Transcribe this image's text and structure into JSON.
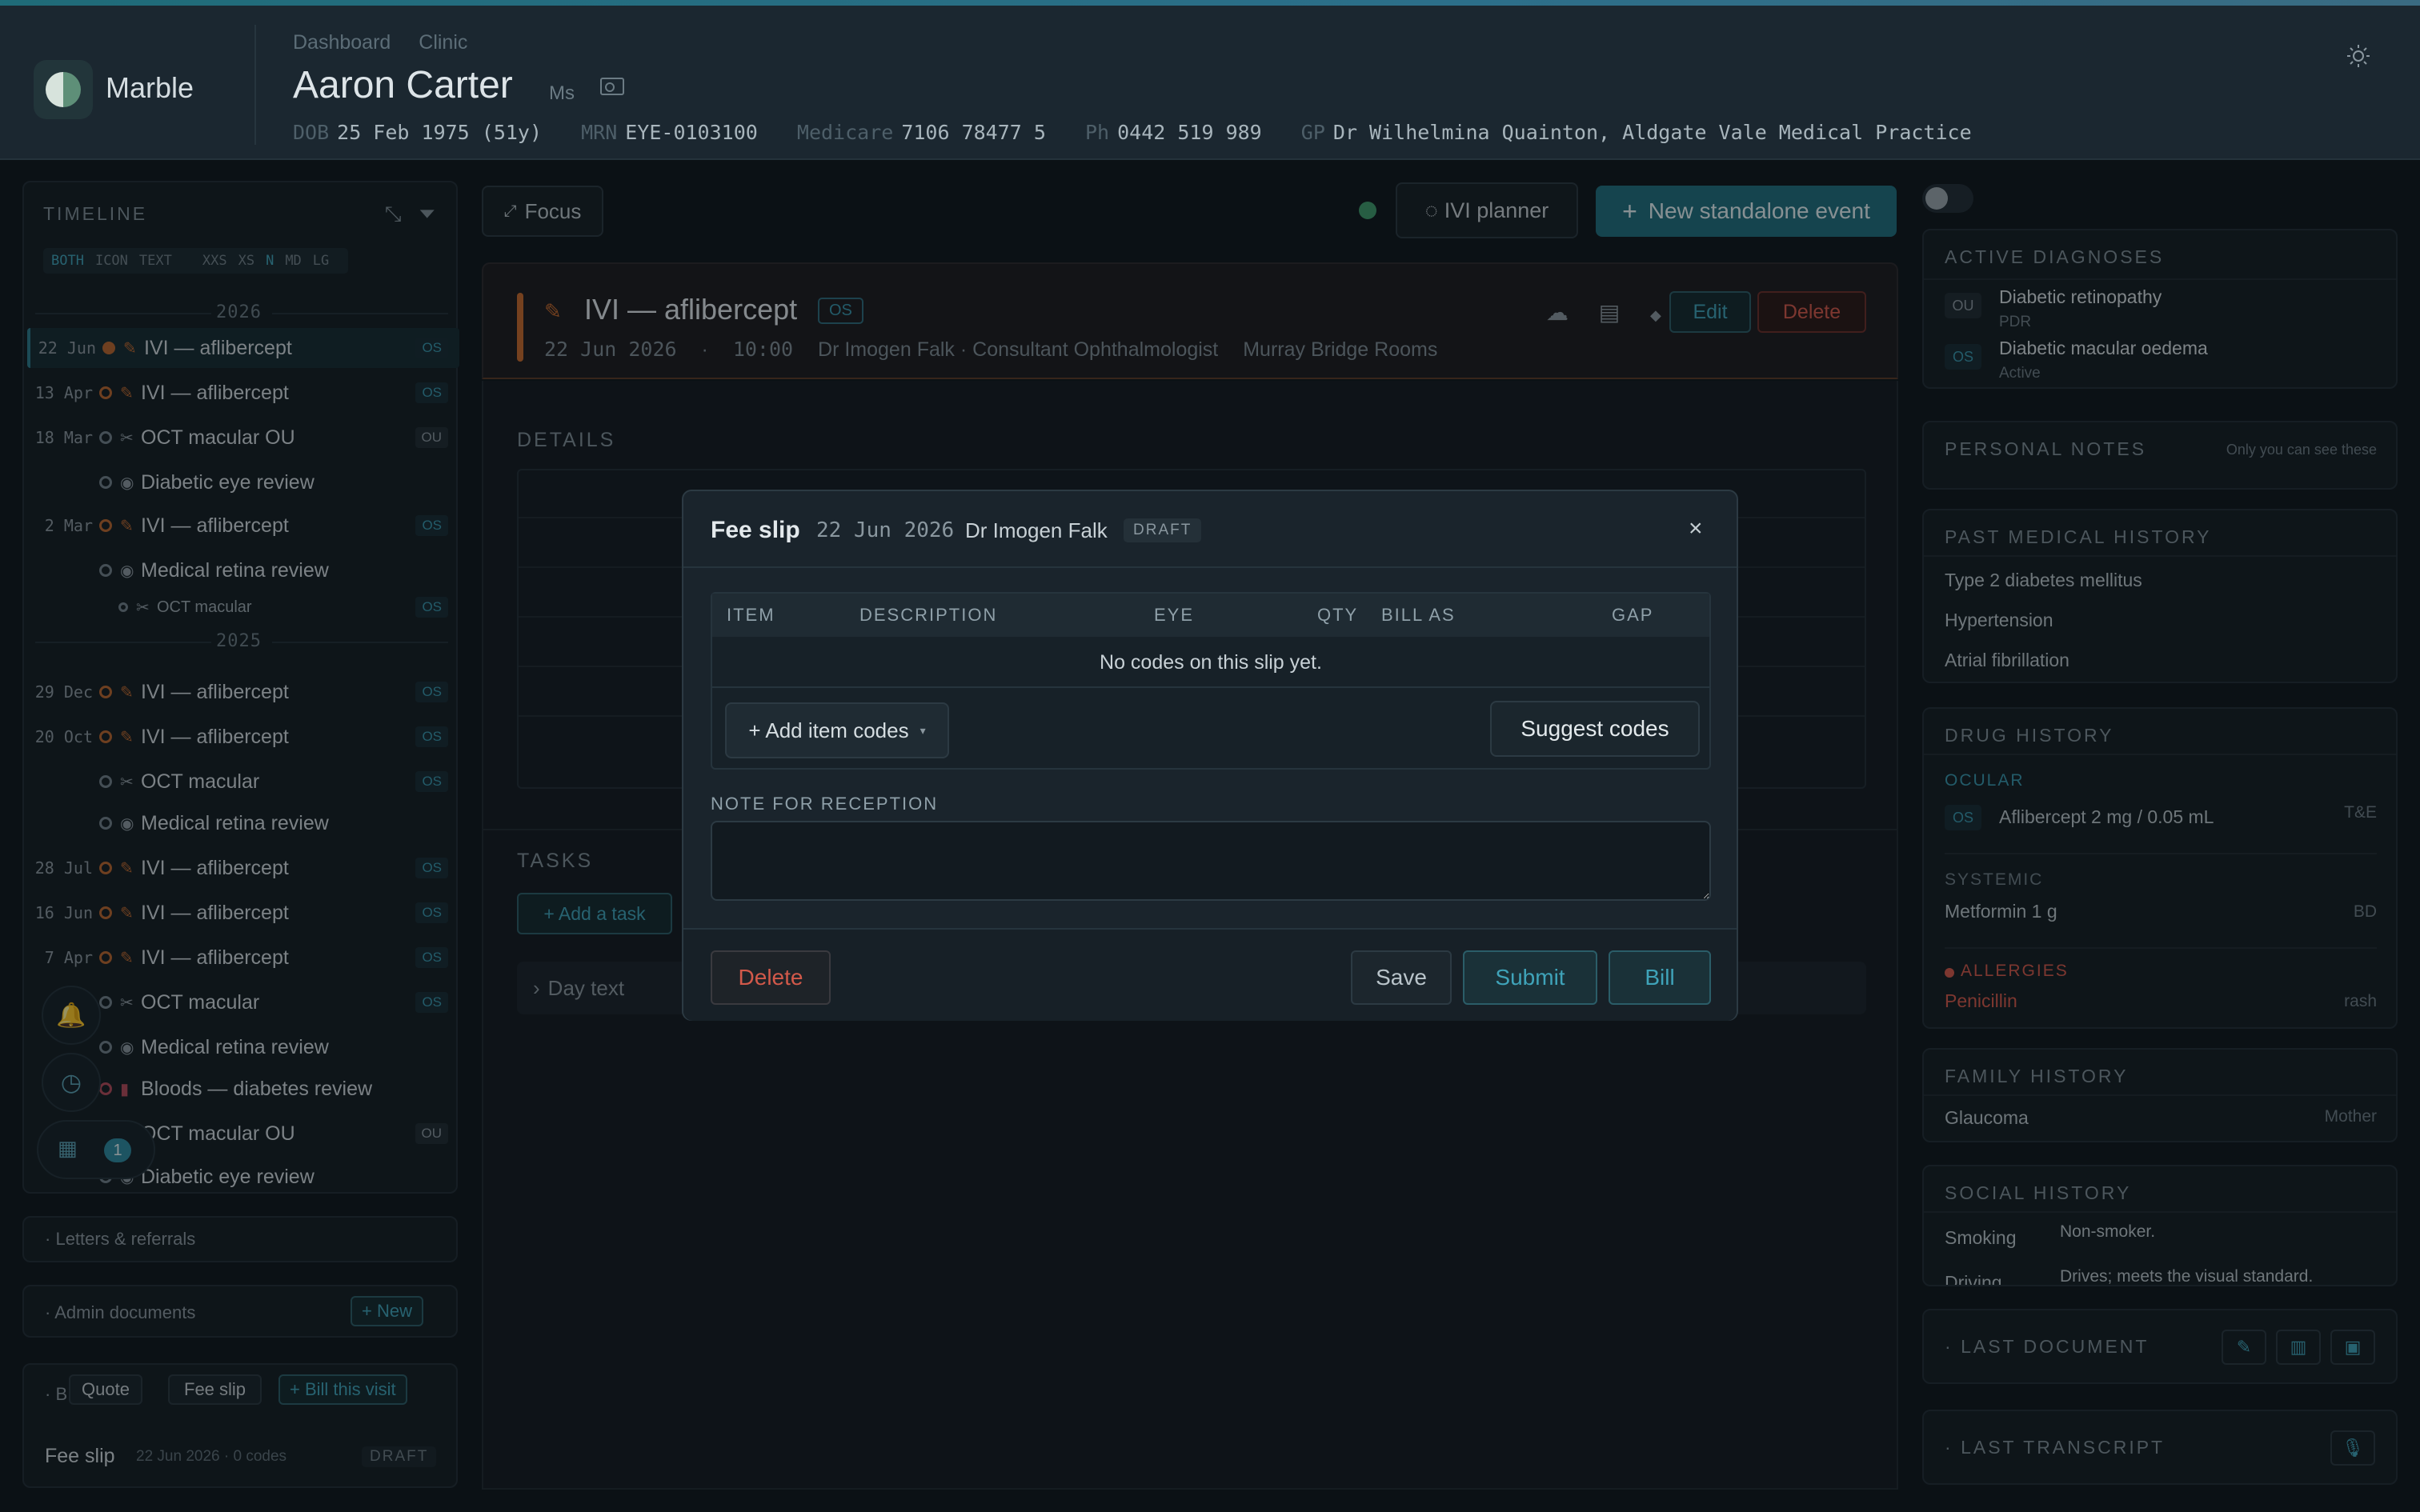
{
  "header": {
    "brand": "Marble",
    "breadcrumbs": [
      "Dashboard",
      "Clinic"
    ],
    "patient_name": "Aaron Carter",
    "title": "Ms",
    "demographics": [
      {
        "label": "DOB",
        "value": "25 Feb 1975 (51y)"
      },
      {
        "label": "MRN",
        "value": "EYE-0103100"
      },
      {
        "label": "Medicare",
        "value": "7106 78477 5"
      },
      {
        "label": "Ph",
        "value": "0442 519 989"
      },
      {
        "label": "GP",
        "value": "Dr Wilhelmina Quainton, Aldgate Vale Medical Practice"
      }
    ]
  },
  "timeline": {
    "title": "TIMELINE",
    "filters": {
      "mode": [
        "BOTH",
        "ICON",
        "TEXT"
      ],
      "sizes": [
        "XXS",
        "XS",
        "N",
        "MD",
        "LG"
      ],
      "active_mode": "BOTH",
      "active_size": "N"
    },
    "years": [
      "2026",
      "2025"
    ],
    "rows": [
      {
        "date": "22 Jun",
        "label": "IVI — aflibercept",
        "eye": "OS",
        "kind": "ivi"
      },
      {
        "date": "13 Apr",
        "label": "IVI — aflibercept",
        "eye": "OS",
        "kind": "ivi"
      },
      {
        "date": "18 Mar",
        "label": "OCT macular OU",
        "eye": "OU",
        "kind": "oct"
      },
      {
        "date": "",
        "label": "Diabetic eye review",
        "eye": "",
        "kind": "review"
      },
      {
        "date": "2 Mar",
        "label": "IVI — aflibercept",
        "eye": "OS",
        "kind": "ivi"
      },
      {
        "date": "",
        "label": "Medical retina review",
        "eye": "",
        "kind": "review"
      },
      {
        "date": "",
        "label": "OCT macular",
        "eye": "OS",
        "kind": "oct-sub"
      },
      {
        "date": "29 Dec",
        "label": "IVI — aflibercept",
        "eye": "OS",
        "kind": "ivi"
      },
      {
        "date": "20 Oct",
        "label": "IVI — aflibercept",
        "eye": "OS",
        "kind": "ivi"
      },
      {
        "date": "",
        "label": "OCT macular",
        "eye": "OS",
        "kind": "oct"
      },
      {
        "date": "",
        "label": "Medical retina review",
        "eye": "",
        "kind": "review"
      },
      {
        "date": "28 Jul",
        "label": "IVI — aflibercept",
        "eye": "OS",
        "kind": "ivi"
      },
      {
        "date": "16 Jun",
        "label": "IVI — aflibercept",
        "eye": "OS",
        "kind": "ivi"
      },
      {
        "date": "7 Apr",
        "label": "IVI — aflibercept",
        "eye": "OS",
        "kind": "ivi"
      },
      {
        "date": "",
        "label": "OCT macular",
        "eye": "OS",
        "kind": "oct"
      },
      {
        "date": "",
        "label": "Medical retina review",
        "eye": "",
        "kind": "review"
      },
      {
        "date": "",
        "label": "Bloods — diabetes review",
        "eye": "",
        "kind": "bloods"
      },
      {
        "date": "",
        "label": "OCT macular OU",
        "eye": "OU",
        "kind": "oct"
      },
      {
        "date": "",
        "label": "Diabetic eye review",
        "eye": "",
        "kind": "review"
      }
    ],
    "notification_count": "1"
  },
  "left_sections": {
    "letters": "Letters & referrals",
    "admin": "Admin documents",
    "admin_new": "+ New",
    "billing_prefix": "B",
    "quote": "Quote",
    "fee_slip": "Fee slip",
    "bill_visit": "+ Bill this visit",
    "fee_slip_row": {
      "title": "Fee slip",
      "meta": "22 Jun 2026 · 0 codes",
      "status": "DRAFT"
    }
  },
  "center": {
    "focus": "Focus",
    "ivi_planner": "IVI planner",
    "new_event": "New standalone event",
    "event": {
      "title": "IVI — aflibercept",
      "eye": "OS",
      "date": "22 Jun 2026",
      "time": "10:00",
      "clinician": "Dr Imogen Falk · Consultant Ophthalmologist",
      "location": "Murray Bridge Rooms",
      "edit": "Edit",
      "delete": "Delete"
    },
    "details_title": "DETAILS",
    "tasks_title": "TASKS",
    "add_task": "+ Add a task",
    "day_text": "Day text"
  },
  "modal": {
    "title": "Fee slip",
    "date": "22 Jun 2026",
    "doctor": "Dr Imogen Falk",
    "status": "DRAFT",
    "columns": [
      "ITEM",
      "DESCRIPTION",
      "EYE",
      "QTY",
      "BILL AS",
      "GAP"
    ],
    "empty": "No codes on this slip yet.",
    "add_codes": "+ Add item codes",
    "suggest": "Suggest codes",
    "note_label": "NOTE FOR RECEPTION",
    "note_value": "",
    "delete": "Delete",
    "save": "Save",
    "submit": "Submit",
    "bill": "Bill"
  },
  "right": {
    "active_diagnoses": {
      "title": "ACTIVE DIAGNOSES",
      "items": [
        {
          "eye": "OU",
          "name": "Diabetic retinopathy",
          "sub": "PDR"
        },
        {
          "eye": "OS",
          "name": "Diabetic macular oedema",
          "sub": "Active"
        }
      ]
    },
    "personal_notes": {
      "title": "PERSONAL NOTES",
      "hint": "Only you can see these"
    },
    "pmh": {
      "title": "PAST MEDICAL HISTORY",
      "items": [
        "Type 2 diabetes mellitus",
        "Hypertension",
        "Atrial fibrillation"
      ]
    },
    "drugs": {
      "title": "DRUG HISTORY",
      "ocular_label": "OCULAR",
      "ocular": {
        "eye": "OS",
        "name": "Aflibercept 2 mg / 0.05 mL",
        "freq": "T&E"
      },
      "systemic_label": "SYSTEMIC",
      "systemic": {
        "name": "Metformin 1 g",
        "freq": "BD"
      },
      "allergies_label": "ALLERGIES",
      "allergy": {
        "name": "Penicillin",
        "reaction": "rash"
      }
    },
    "family": {
      "title": "FAMILY HISTORY",
      "item": "Glaucoma",
      "relation": "Mother"
    },
    "social": {
      "title": "SOCIAL HISTORY",
      "rows": [
        {
          "k": "Smoking",
          "v": "Non-smoker."
        },
        {
          "k": "Driving",
          "v": "Drives; meets the visual standard."
        }
      ]
    },
    "last_document": "LAST DOCUMENT",
    "last_transcript": "LAST TRANSCRIPT"
  },
  "colors": {
    "accent": "#1f6f7e",
    "ivi": "#c46a2d",
    "danger": "#d2594a",
    "eye": "#3796ad"
  }
}
